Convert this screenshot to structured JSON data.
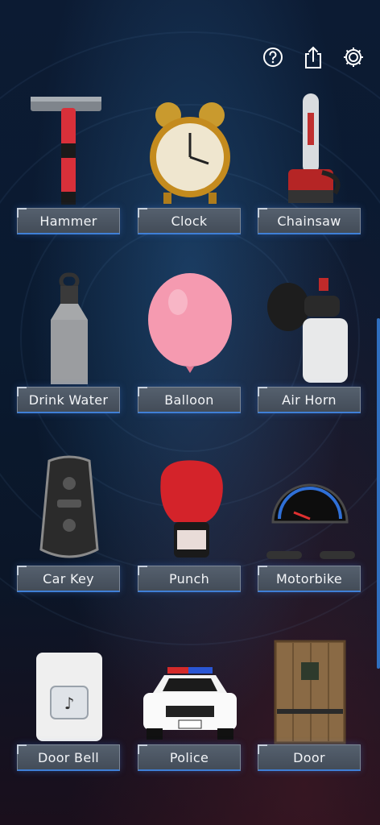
{
  "toolbar": {
    "icons": [
      "question-icon",
      "share-icon",
      "gear-icon"
    ]
  },
  "sounds": [
    {
      "id": "hammer",
      "label": "Hammer",
      "icon": "hammer-icon"
    },
    {
      "id": "clock",
      "label": "Clock",
      "icon": "alarm-clock-icon"
    },
    {
      "id": "chainsaw",
      "label": "Chainsaw",
      "icon": "chainsaw-icon"
    },
    {
      "id": "drink-water",
      "label": "Drink Water",
      "icon": "water-bottle-icon"
    },
    {
      "id": "balloon",
      "label": "Balloon",
      "icon": "balloon-icon"
    },
    {
      "id": "air-horn",
      "label": "Air Horn",
      "icon": "air-horn-icon"
    },
    {
      "id": "car-key",
      "label": "Car Key",
      "icon": "car-key-icon"
    },
    {
      "id": "punch",
      "label": "Punch",
      "icon": "boxing-glove-icon"
    },
    {
      "id": "motorbike",
      "label": "Motorbike",
      "icon": "motorbike-gauge-icon"
    },
    {
      "id": "door-bell",
      "label": "Door Bell",
      "icon": "door-bell-icon"
    },
    {
      "id": "police",
      "label": "Police",
      "icon": "police-car-icon"
    },
    {
      "id": "door",
      "label": "Door",
      "icon": "door-icon"
    }
  ],
  "colors": {
    "accent": "#3f7fd6",
    "label_bg": "#4b5562",
    "label_text": "#f2f4f7"
  }
}
